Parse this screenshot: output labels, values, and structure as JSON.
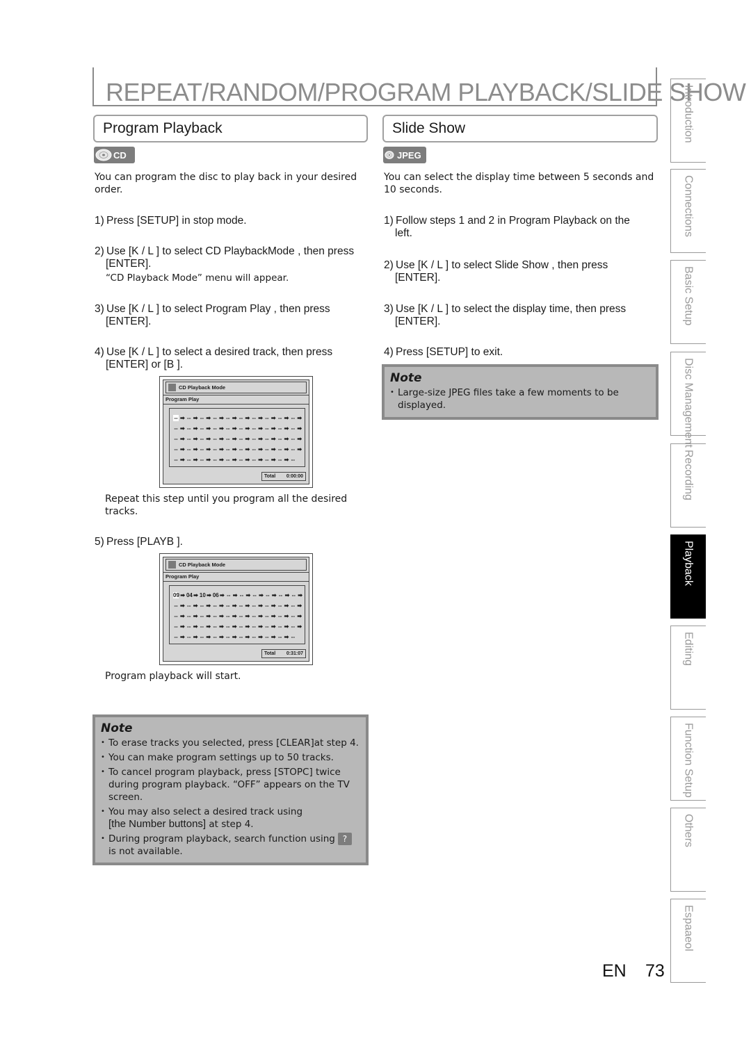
{
  "page": {
    "title": "REPEAT/RANDOM/PROGRAM PLAYBACK/SLIDE SHOW",
    "language": "EN",
    "number": "73"
  },
  "left": {
    "header": "Program Playback",
    "badge": "CD",
    "intro": "You can program the disc to play back in your desired order.",
    "steps": [
      {
        "num": "1)",
        "line1": "Press [SETUP] in stop mode.",
        "line2": ""
      },
      {
        "num": "2)",
        "line1": "Use [K / L ] to select  CD PlaybackMode , then press",
        "line2": "[ENTER]."
      },
      {
        "num": "3)",
        "line1": "Use [K / L ] to select  Program Play , then press",
        "line2": "[ENTER]."
      },
      {
        "num": "4)",
        "line1": "Use [K / L ] to select a desired track, then press",
        "line2": "[ENTER] or [B ]."
      },
      {
        "num": "5)",
        "line1": "Press [PLAYB ].",
        "line2": ""
      }
    ],
    "step2_sub": "“CD Playback Mode” menu will appear.",
    "step4_sub": "Repeat this step until you program all the desired tracks.",
    "step5_sub": "Program playback will start.",
    "osd1": {
      "head": "CD Playback Mode",
      "sub": "Program Play",
      "rows": [
        [
          "--",
          "--",
          "--",
          "--",
          "--",
          "--",
          "--",
          "--",
          "--",
          "--"
        ],
        [
          "--",
          "--",
          "--",
          "--",
          "--",
          "--",
          "--",
          "--",
          "--",
          "--"
        ],
        [
          "--",
          "--",
          "--",
          "--",
          "--",
          "--",
          "--",
          "--",
          "--",
          "--"
        ],
        [
          "--",
          "--",
          "--",
          "--",
          "--",
          "--",
          "--",
          "--",
          "--",
          "--"
        ],
        [
          "--",
          "--",
          "--",
          "--",
          "--",
          "--",
          "--",
          "--",
          "--",
          "--"
        ]
      ],
      "total_label": "Total",
      "total_value": "0:00:00"
    },
    "osd2": {
      "head": "CD Playback Mode",
      "sub": "Program Play",
      "rows": [
        [
          "09",
          "04",
          "10",
          "06",
          "--",
          "--",
          "--",
          "--",
          "--",
          "--"
        ],
        [
          "--",
          "--",
          "--",
          "--",
          "--",
          "--",
          "--",
          "--",
          "--",
          "--"
        ],
        [
          "--",
          "--",
          "--",
          "--",
          "--",
          "--",
          "--",
          "--",
          "--",
          "--"
        ],
        [
          "--",
          "--",
          "--",
          "--",
          "--",
          "--",
          "--",
          "--",
          "--",
          "--"
        ],
        [
          "--",
          "--",
          "--",
          "--",
          "--",
          "--",
          "--",
          "--",
          "--",
          "--"
        ]
      ],
      "total_label": "Total",
      "total_value": "0:31:07"
    },
    "note": {
      "title": "Note",
      "items": [
        "To erase tracks you selected, press [CLEAR]at step 4.",
        "You can make program settings up to 50 tracks.",
        "To cancel program playback, press [STOPC] twice during program playback. “OFF” appears on the TV screen.",
        "You may also select a desired track using",
        "[the Number buttons]",
        " at step 4.",
        "During program playback, search function using",
        "is not available."
      ]
    }
  },
  "right": {
    "header": "Slide Show",
    "badge": "JPEG",
    "intro": "You can select the display time between 5 seconds and 10 seconds.",
    "steps": [
      {
        "num": "1)",
        "line1": "Follow steps 1 and 2 in  Program Playback  on the",
        "line2": "left."
      },
      {
        "num": "2)",
        "line1": "Use [K / L ] to select  Slide Show , then press",
        "line2": "[ENTER]."
      },
      {
        "num": "3)",
        "line1": "Use [K / L ] to select the display time, then press",
        "line2": "[ENTER]."
      },
      {
        "num": "4)",
        "line1": "Press [SETUP] to exit.",
        "line2": ""
      }
    ],
    "note": {
      "title": "Note",
      "items": [
        "Large-size JPEG files take a few moments to be displayed."
      ]
    }
  },
  "tabs": [
    {
      "label": "Introduction",
      "active": false
    },
    {
      "label": "Connections",
      "active": false
    },
    {
      "label": "Basic Setup",
      "active": false
    },
    {
      "label": "Disc Management",
      "active": false
    },
    {
      "label": "Recording",
      "active": false
    },
    {
      "label": "Playback",
      "active": true
    },
    {
      "label": "Editing",
      "active": false
    },
    {
      "label": "Function Setup",
      "active": false
    },
    {
      "label": "Others",
      "active": false
    },
    {
      "label": "Espaaeol",
      "active": false
    }
  ],
  "colors": {
    "title_gray": "#8c8c8c",
    "badge_gray": "#7d7d7d",
    "note_bg": "#b8b8b8",
    "note_border": "#8a8a8a",
    "active_tab": "#000000"
  }
}
